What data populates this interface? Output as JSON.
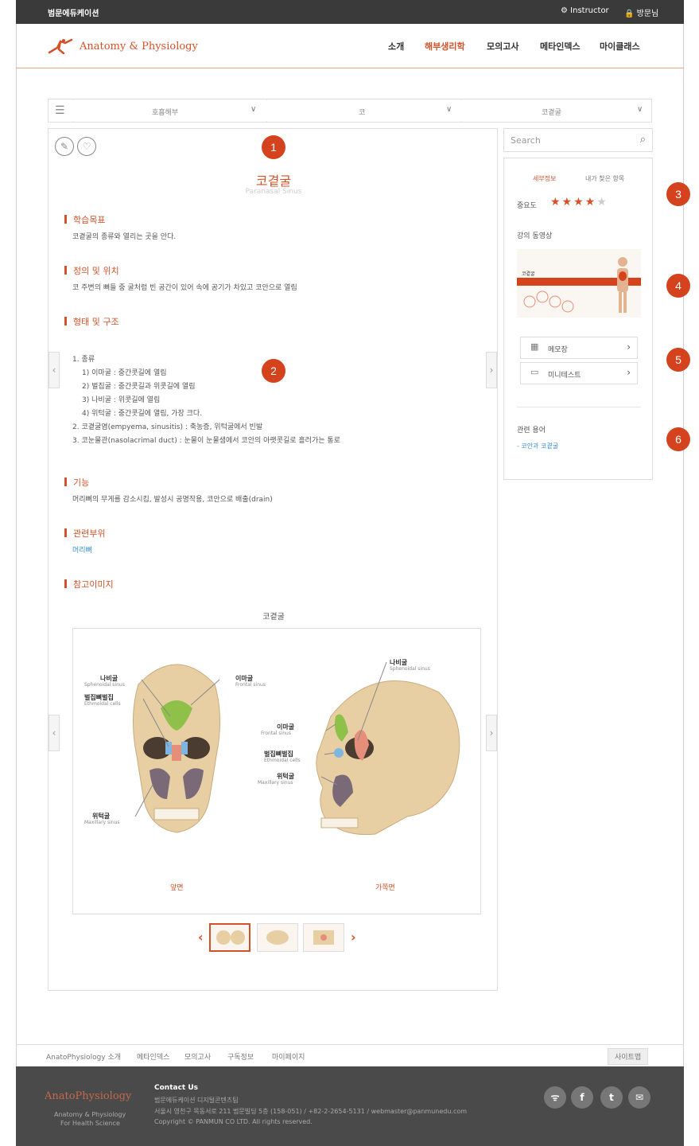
{
  "topbar": {
    "brand": "범문에듀케이션",
    "instructor": "Instructor",
    "visitor": "방문님"
  },
  "header": {
    "logo": "Anatomy & Physiology",
    "nav": [
      "소개",
      "해부생리학",
      "모의고사",
      "메타인덱스",
      "마이클래스"
    ],
    "active_color": "#d4522a"
  },
  "breadcrumb": {
    "items": [
      "호흡해부",
      "코",
      "코곁굴"
    ]
  },
  "article": {
    "title": "코곁굴",
    "subtitle": "Paranasal Sinus",
    "sections": [
      {
        "heading": "학습목표",
        "text": "코곁굴의 종류와 열리는 곳을 안다."
      },
      {
        "heading": "정의 및 위치",
        "text": "코 주변의 뼈들 중 굴처럼 빈 공간이 있어 속에 공기가 차있고 코안으로 열림"
      },
      {
        "heading": "형태 및 구조"
      },
      {
        "heading": "기능",
        "text": "머리뼈의 무게를 감소시킴, 발성시 공명작용, 코안으로 배출(drain)"
      },
      {
        "heading": "관련부위",
        "text": "머리뼈"
      },
      {
        "heading": "참고이미지"
      }
    ],
    "structure_lines": [
      "1. 종류",
      "1) 이마굴 : 중간콧길에 열림",
      "2) 벌집굴 : 중간콧길과 위콧길에 열림",
      "3) 나비굴 : 위콧길에 열림",
      "4) 위턱굴 : 중간콧길에 열림, 가장 크다.",
      "2. 코곁굴염(empyema, sinusitis) : 축농증, 위턱굴에서 빈발",
      "3. 코눈물관(nasolacrimal duct) : 눈물이 눈물샘에서 코안의 아랫콧길로 흘러가는 통로"
    ],
    "figure": {
      "caption": "코곁굴",
      "front_label": "앞면",
      "side_label": "가쪽면",
      "labels": {
        "sphenoid_ko": "나비굴",
        "sphenoid_en": "Sphenoidal sinus",
        "ethmoid_ko": "벌집뼈벌집",
        "ethmoid_en": "Ethmoidal cells",
        "frontal_ko": "이마굴",
        "frontal_en": "Frontal sinus",
        "maxillary_ko": "위턱굴",
        "maxillary_en": "Maxillary sinus"
      }
    }
  },
  "sidebar": {
    "search_placeholder": "Search",
    "tabs": [
      "세부정보",
      "내가 찾은 항목"
    ],
    "importance_label": "중요도",
    "importance_rating": 4,
    "importance_max": 5,
    "video_label": "강의 동영상",
    "video_thumb_title": "코곁굴",
    "buttons": [
      "메모장",
      "미니테스트"
    ],
    "related_label": "관련 용어",
    "related_link": "- 코안과 코곁굴"
  },
  "badges": [
    "1",
    "2",
    "3",
    "4",
    "5",
    "6"
  ],
  "footer": {
    "links": [
      "AnatoPhysiology 소개",
      "메타인덱스",
      "모의고사",
      "구독정보",
      "마이페이지"
    ],
    "sitemap": "사이트맵",
    "brand": "AnatoPhysiology",
    "brand_sub1": "Anatomy & Physiology",
    "brand_sub2": "For Health Science",
    "contact_title": "Contact Us",
    "contact_line1": "범문에듀케이션 디지털콘텐츠팀",
    "contact_line2": "서울시 영천구 목동서로 211 범문빌딩 5층 (158-051) / +82-2-2654-5131 / webmaster@panmunedu.com",
    "contact_line3": "Copyright © PANMUN CO LTD. All rights reserved."
  }
}
